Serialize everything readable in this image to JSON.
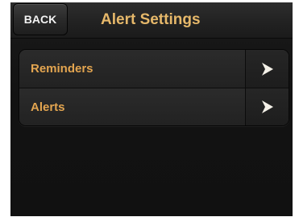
{
  "header": {
    "back_label": "BACK",
    "title": "Alert Settings"
  },
  "menu": {
    "items": [
      {
        "label": "Reminders",
        "icon": "chevron-right-icon"
      },
      {
        "label": "Alerts",
        "icon": "chevron-right-icon"
      }
    ]
  },
  "colors": {
    "title": "#e6b86a",
    "item_label": "#e3a550",
    "background": "#121212"
  }
}
